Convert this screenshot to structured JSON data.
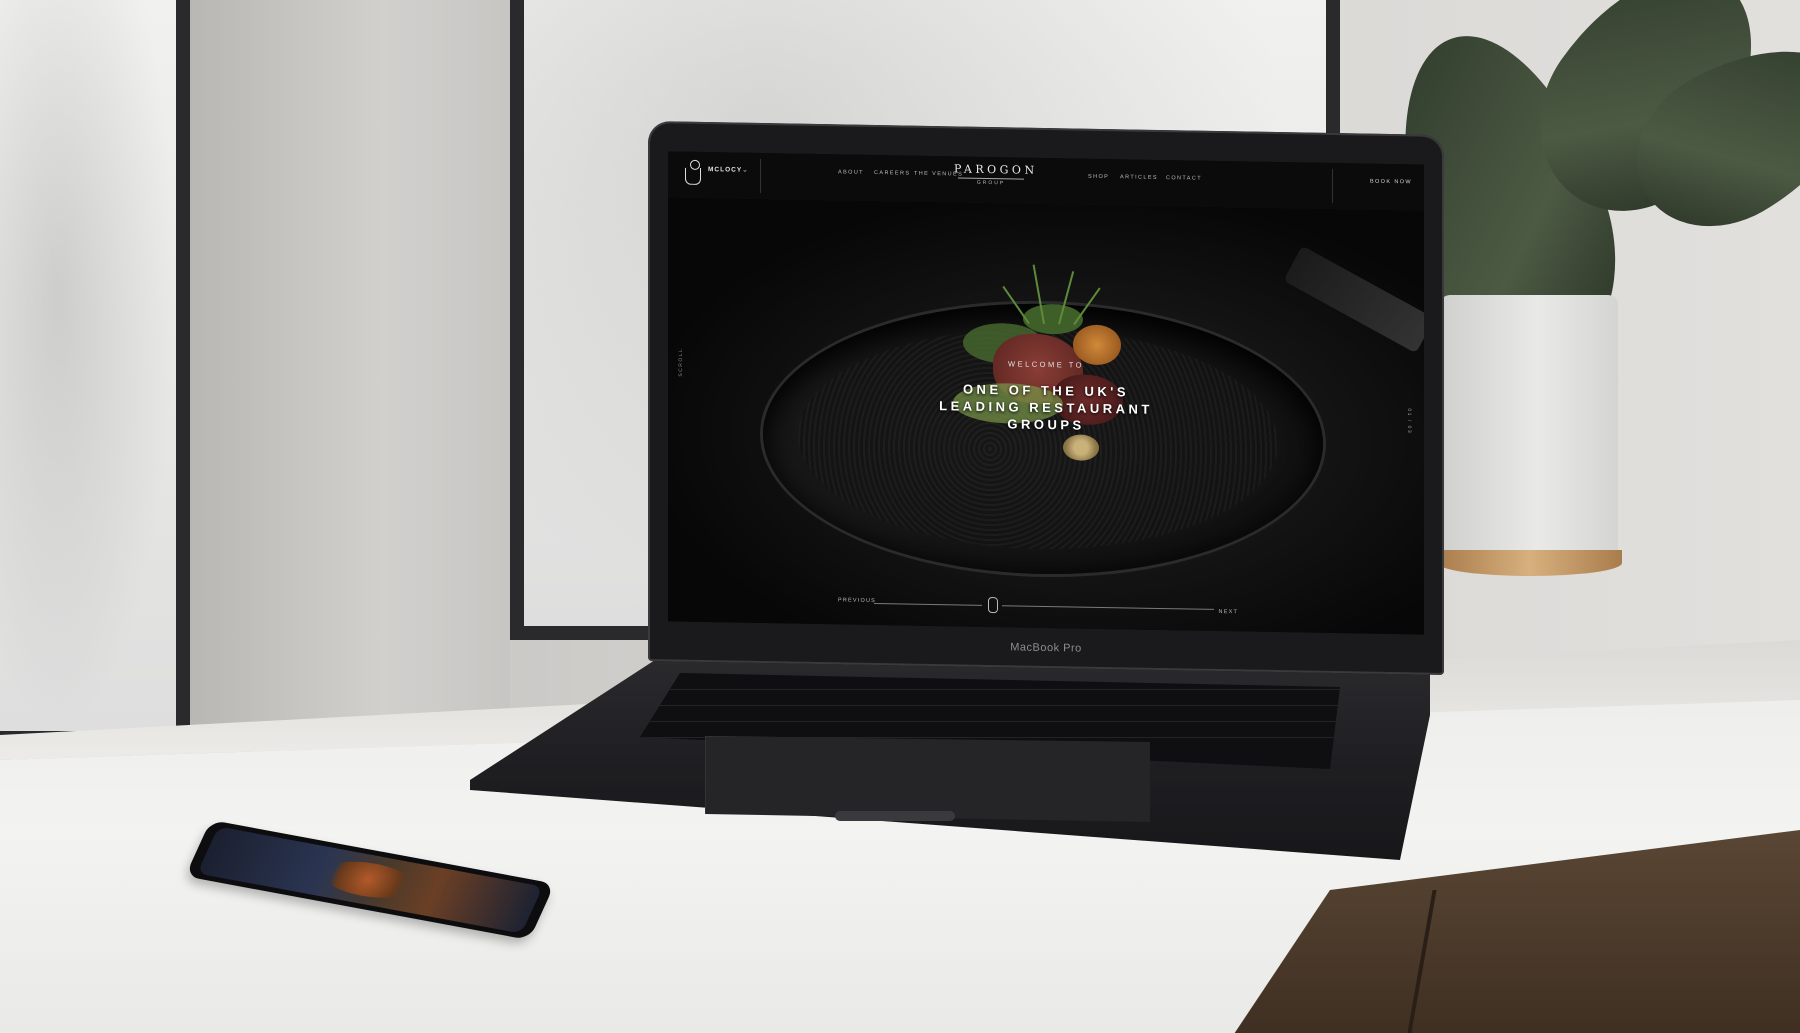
{
  "device": {
    "laptop_label": "MacBook Pro"
  },
  "site": {
    "venue_selector": "MCLOCY",
    "nav_left": [
      "ABOUT",
      "CAREERS",
      "THE VENUES"
    ],
    "brand_name": "PAROGON",
    "brand_sub": "GROUP",
    "nav_right": [
      "SHOP",
      "ARTICLES",
      "CONTACT"
    ],
    "book_now": "BOOK NOW",
    "hero": {
      "kicker": "WELCOME TO",
      "title_lines": [
        "ONE OF THE UK'S",
        "LEADING RESTAURANT",
        "GROUPS"
      ]
    },
    "side_left": "SCROLL",
    "side_right": "01 / 03",
    "slider": {
      "previous": "PREVIOUS",
      "next": "NEXT"
    }
  },
  "colors": {
    "nav_bg": "#0b0b0b",
    "hero_text": "#ffffff",
    "laptop_body": "#1a1a1c"
  }
}
